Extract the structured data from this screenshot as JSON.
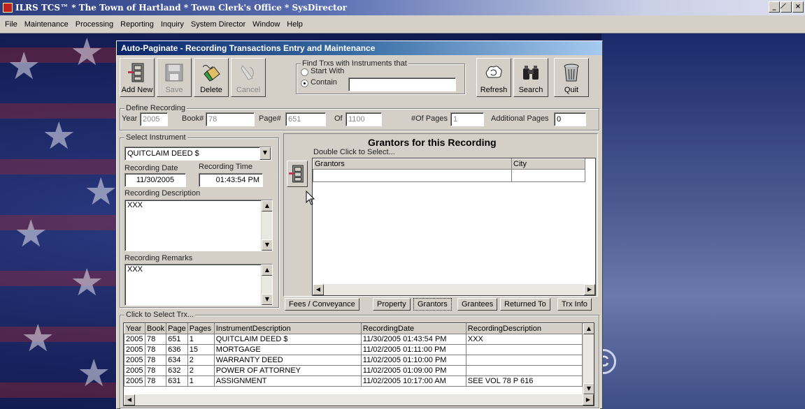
{
  "app": {
    "title": "ILRS TCS™ * The Town of Hartland * Town Clerk's Office * SysDirector",
    "controls": [
      "_",
      "̸",
      "×"
    ]
  },
  "menu": [
    "File",
    "Maintenance",
    "Processing",
    "Reporting",
    "Inquiry",
    "System Director",
    "Window",
    "Help"
  ],
  "dialog": {
    "title": "Auto-Paginate - Recording Transactions Entry and Maintenance",
    "toolbar": {
      "add_new": "Add New",
      "save": "Save",
      "delete": "Delete",
      "cancel": "Cancel",
      "refresh": "Refresh",
      "search": "Search",
      "quit": "Quit"
    },
    "find": {
      "group_label": "Find Trxs with Instruments that",
      "start_with": "Start With",
      "contain": "Contain",
      "selected": "contain",
      "value": ""
    },
    "define": {
      "group_label": "Define Recording",
      "year_label": "Year",
      "year": "2005",
      "book_label": "Book#",
      "book": "78",
      "page_label": "Page#",
      "page": "651",
      "of_label": "Of",
      "of": "1100",
      "num_pages_label": "#Of Pages",
      "num_pages": "1",
      "additional_label": "Additional Pages",
      "additional": "0"
    },
    "instrument": {
      "group_label": "Select Instrument",
      "selected": "QUITCLAIM DEED $",
      "rec_date_label": "Recording Date",
      "rec_date": "11/30/2005",
      "rec_time_label": "Recording Time",
      "rec_time": "01:43:54 PM",
      "desc_label": "Recording Description",
      "desc": "XXX",
      "remarks_label": "Recording Remarks",
      "remarks": "XXX"
    },
    "grantors": {
      "title": "Grantors for this Recording",
      "hint": "Double Click to Select...",
      "col_grantors": "Grantors",
      "col_city": "City"
    },
    "tabs": [
      "Fees / Conveyance",
      "Property",
      "Grantors",
      "Grantees",
      "Returned To",
      "Trx Info"
    ],
    "active_tab": "Grantors",
    "trx": {
      "group_label": "Click to Select Trx...",
      "columns": [
        "Year",
        "Book",
        "Page",
        "Pages",
        "InstrumentDescription",
        "RecordingDate",
        "RecordingDescription"
      ],
      "rows": [
        [
          "2005",
          "78",
          "651",
          "1",
          "QUITCLAIM DEED $",
          "11/30/2005 01:43:54 PM",
          "XXX"
        ],
        [
          "2005",
          "78",
          "636",
          "15",
          "MORTGAGE",
          "11/02/2005 01:11:00 PM",
          ""
        ],
        [
          "2005",
          "78",
          "634",
          "2",
          "WARRANTY DEED",
          "11/02/2005 01:10:00 PM",
          ""
        ],
        [
          "2005",
          "78",
          "632",
          "2",
          "POWER OF ATTORNEY",
          "11/02/2005 01:09:00 PM",
          ""
        ],
        [
          "2005",
          "78",
          "631",
          "1",
          "ASSIGNMENT",
          "11/02/2005 10:17:00 AM",
          "SEE VOL 78 P 616"
        ]
      ]
    }
  },
  "desktop": {
    "copyright_symbol": "C"
  }
}
